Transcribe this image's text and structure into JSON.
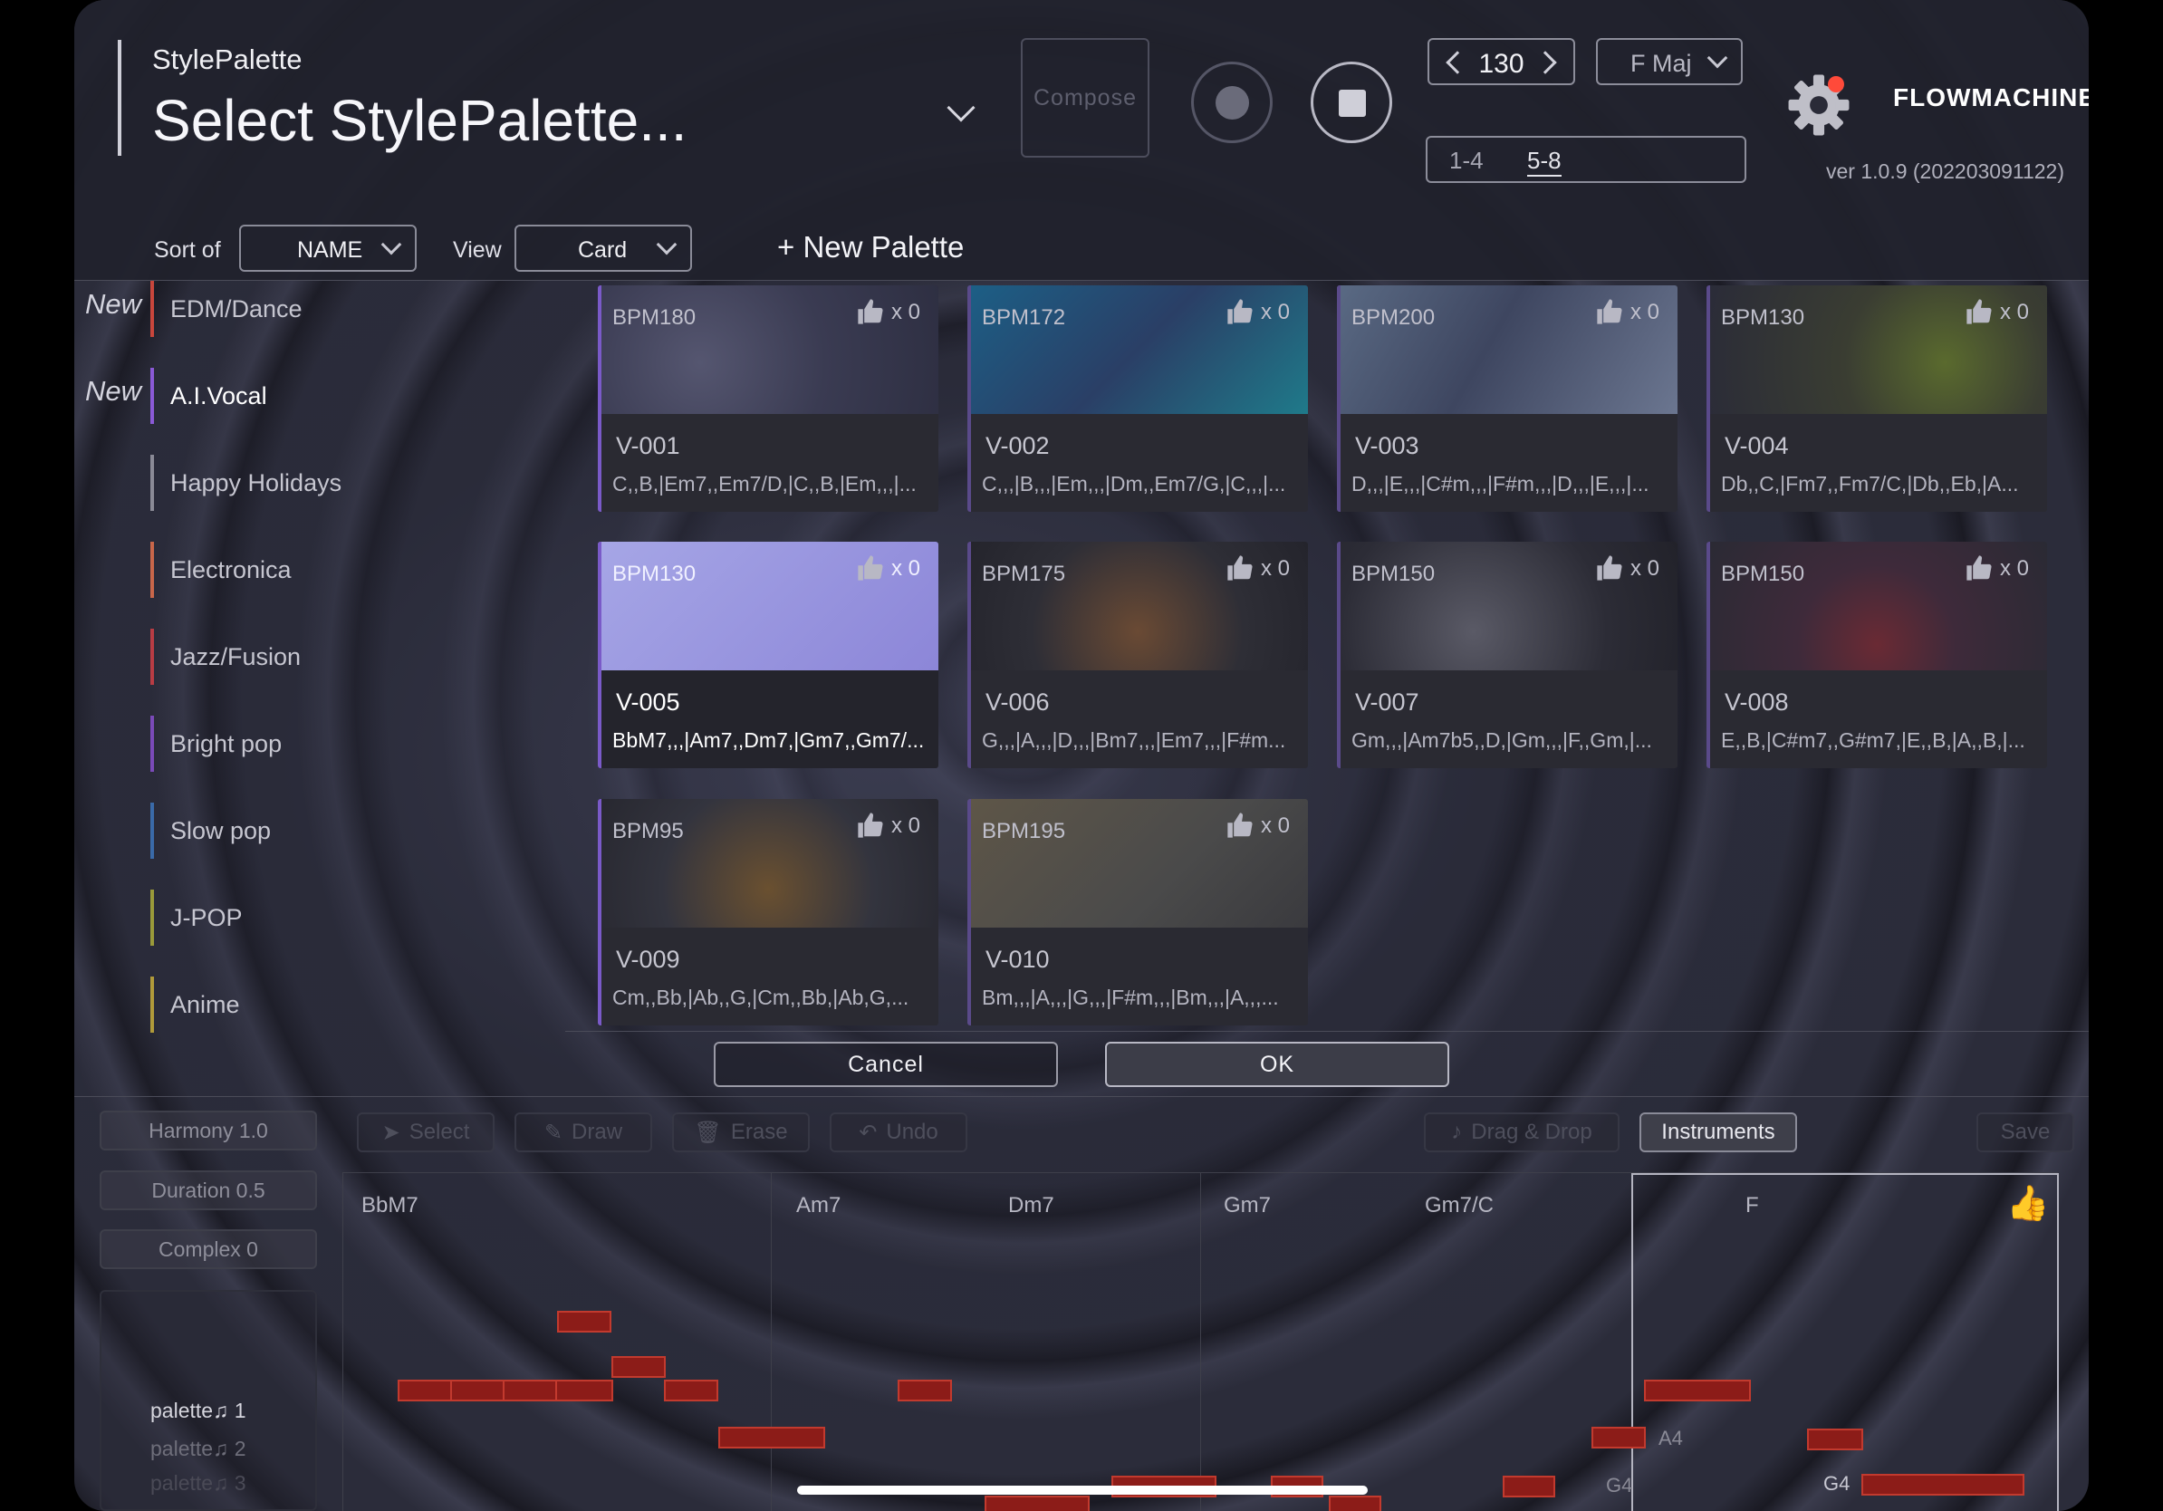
{
  "header": {
    "app_label": "StylePalette",
    "palette_title": "Select StylePalette...",
    "compose_label": "Compose",
    "tempo": "130",
    "key": "F Maj",
    "bars": [
      "1-4",
      "5-8"
    ],
    "bars_selected": "5-8",
    "brand": "FLOWMACHINES",
    "version": "ver 1.0.9 (202203091122)"
  },
  "toolbar": {
    "sort_label": "Sort of",
    "sort_value": "NAME",
    "view_label": "View",
    "view_value": "Card",
    "new_palette": "+ New Palette"
  },
  "categories": [
    {
      "new_tag": "New",
      "name": "EDM/Dance",
      "color": "#c8463c"
    },
    {
      "new_tag": "New",
      "name": "A.I.Vocal",
      "color": "#8a5ad6"
    },
    {
      "new_tag": "",
      "name": "Happy Holidays",
      "color": "#8a8a96"
    },
    {
      "new_tag": "",
      "name": "Electronica",
      "color": "#c8664a"
    },
    {
      "new_tag": "",
      "name": "Jazz/Fusion",
      "color": "#b83c44"
    },
    {
      "new_tag": "",
      "name": "Bright pop",
      "color": "#7a4ab8"
    },
    {
      "new_tag": "",
      "name": "Slow pop",
      "color": "#3a6aa8"
    },
    {
      "new_tag": "",
      "name": "J-POP",
      "color": "#9a9a3a"
    },
    {
      "new_tag": "",
      "name": "Anime",
      "color": "#b09a3a"
    }
  ],
  "selected_category": "A.I.Vocal",
  "cards": [
    {
      "bpm": "BPM180",
      "likes": "x 0",
      "name": "V-001",
      "chords": "C,,B,|Em7,,Em7/D,|C,,B,|Em,,,|..."
    },
    {
      "bpm": "BPM172",
      "likes": "x 0",
      "name": "V-002",
      "chords": "C,,,|B,,,|Em,,,|Dm,,Em7/G,|C,,,|..."
    },
    {
      "bpm": "BPM200",
      "likes": "x 0",
      "name": "V-003",
      "chords": "D,,,|E,,,|C#m,,,|F#m,,,|D,,,|E,,,|..."
    },
    {
      "bpm": "BPM130",
      "likes": "x 0",
      "name": "V-004",
      "chords": "Db,,C,|Fm7,,Fm7/C,|Db,,Eb,|A..."
    },
    {
      "bpm": "BPM130",
      "likes": "x 0",
      "name": "V-005",
      "chords": "BbM7,,,|Am7,,Dm7,|Gm7,,Gm7/..."
    },
    {
      "bpm": "BPM175",
      "likes": "x 0",
      "name": "V-006",
      "chords": "G,,,|A,,,|D,,,|Bm7,,,|Em7,,,|F#m..."
    },
    {
      "bpm": "BPM150",
      "likes": "x 0",
      "name": "V-007",
      "chords": "Gm,,,|Am7b5,,D,|Gm,,,|F,,Gm,|..."
    },
    {
      "bpm": "BPM150",
      "likes": "x 0",
      "name": "V-008",
      "chords": "E,,B,|C#m7,,G#m7,|E,,B,|A,,B,|..."
    },
    {
      "bpm": "BPM95",
      "likes": "x 0",
      "name": "V-009",
      "chords": "Cm,,Bb,|Ab,,G,|Cm,,Bb,|Ab,G,..."
    },
    {
      "bpm": "BPM195",
      "likes": "x 0",
      "name": "V-010",
      "chords": "Bm,,,|A,,,|G,,,|F#m,,,|Bm,,,|A,,,..."
    }
  ],
  "selected_card": "V-005",
  "dialog": {
    "cancel": "Cancel",
    "ok": "OK"
  },
  "editor": {
    "harmony": "Harmony 1.0",
    "duration": "Duration 0.5",
    "complex": "Complex 0",
    "tools": [
      "Select",
      "Draw",
      "Erase",
      "Undo"
    ],
    "drag_drop": "Drag & Drop",
    "instruments": "Instruments",
    "save": "Save",
    "palettes": [
      "palette♫ 1",
      "palette♫ 2",
      "palette♫ 3"
    ],
    "chords": [
      "BbM7",
      "Am7",
      "Dm7",
      "Gm7",
      "Gm7/C",
      "F"
    ],
    "note_labels": [
      "A4",
      "G4",
      "A4",
      "G4"
    ]
  }
}
